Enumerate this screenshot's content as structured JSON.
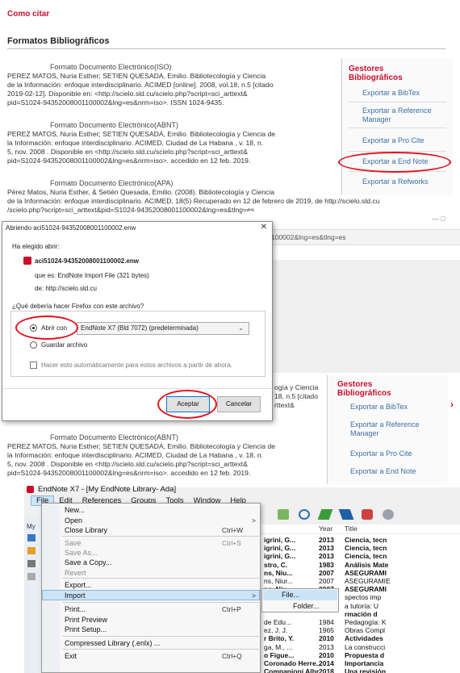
{
  "cite_page": {
    "heading": "Como citar",
    "section_title": "Formatos Bibliográficos",
    "formats": [
      {
        "title": "Formato Documento Electrónico(ISO)",
        "lines": [
          "PEREZ MATOS, Nuria Esther; SETIEN QUESADA, Emilio. Bibliotecología y Ciencia",
          "de la Información: enfoque interdisciplinario. ACIMED [online]. 2008, vol.18, n.5 [citado",
          "2019-02-12]. Disponible en: <http://scielo.sld.cu/scielo.php?script=sci_arttext&",
          "pid=S1024-94352008001100002&lng=es&nrm=iso>. ISSN 1024-9435."
        ]
      },
      {
        "title": "Formato Documento Electrónico(ABNT)",
        "lines": [
          "PEREZ MATOS, Nuria Esther; SETIEN QUESADA, Emilio. Bibliotecología y Ciencia de",
          "la Información: enfoque interdisciplinario. ACIMED, Ciudad de La Habana , v. 18, n.",
          "5, nov. 2008 . Disponible en <http://scielo.sld.cu/scielo.php?script=sci_arttext&",
          "pid=S1024-94352008001100002&lng=es&nrm=iso>. accedido en 12 feb. 2019."
        ]
      },
      {
        "title": "Formato Documento Electrónico(APA)",
        "lines": [
          "Pérez Matos, Nuria Esther, & Setién Quesada, Emilio. (2008). Bibliotecología y Ciencia",
          "de la Información: enfoque interdisciplinario. ACIMED, 18(5) Recuperado en 12 de febrero de 2019, de http://scielo.sld.cu",
          "/scielo.php?script=sci_arttext&pid=S1024-94352008001100002&lng=es&tlng=es."
        ]
      }
    ],
    "gestores": {
      "title_line1": "Gestores",
      "title_line2": "Bibliográficos",
      "links": [
        "Exportar a BibTex",
        "Exportar a Reference",
        "Manager",
        "Exportar a Pro Cite",
        "Exportar a End Note",
        "Exportar a Refworks"
      ]
    },
    "url_fragment": "100002&lng=es&tlng=es",
    "window_controls": "—   □"
  },
  "dialog": {
    "title": "Abriendo aci51024-94352008001100002.enw",
    "close_glyph": "✕",
    "chosen_label": "Ha elegido abrir:",
    "filename": "aci51024-94352008001100002.enw",
    "type_label": "que es: EndNote Import File (321 bytes)",
    "from_label": "de: http://scielo.sld.cu",
    "question": "¿Qué debería hacer Firefox con este archivo?",
    "open_with_label": "Abrir con",
    "open_with_app": "EndNote X7 (Bld 7072) (predeterminada)",
    "save_label": "Guardar archivo",
    "auto_label": "Hacer esto automáticamente para estos archivos a partir de ahora.",
    "accept": "Aceptar",
    "cancel": "Cancelar"
  },
  "second_page": {
    "snippet_lines": [
      "ogía y Ciencia",
      "18, n.5 [citado",
      "rttext&"
    ],
    "abnt_title": "Formato Documento Electrónico(ABNT)",
    "abnt_lines": [
      "PEREZ MATOS, Nuria Esther; SETIEN QUESADA, Emilio. Bibliotecología y Ciencia de",
      "la Información: enfoque interdisciplinario. ACIMED, Ciudad de La Habana , v. 18, n.",
      "5, nov. 2008 . Disponible en <http://scielo.sld.cu/scielo.php?script=sci_arttext&",
      "pid=S1024-94352008001100002&lng=es&nrm=iso>. accedido en 12 feb. 2019."
    ],
    "gestores": {
      "title_line1": "Gestores",
      "title_line2": "Bibliográficos",
      "links": [
        "Exportar a BibTex",
        "Exportar a Reference",
        "Manager",
        "Exportar a Pro Cite",
        "Exportar a End Note"
      ]
    }
  },
  "endnote": {
    "title": "EndNote X7 - [My EndNote Library- Ada]",
    "menubar": [
      "File",
      "Edit",
      "References",
      "Groups",
      "Tools",
      "Window",
      "Help"
    ],
    "file_menu": [
      {
        "label": "New...",
        "shortcut": "",
        "disabled": false
      },
      {
        "label": "Open",
        "shortcut": ">",
        "disabled": false
      },
      {
        "label": "Close Library",
        "shortcut": "Ctrl+W",
        "disabled": false
      },
      {
        "label": "Save",
        "shortcut": "Ctrl+S",
        "disabled": true
      },
      {
        "label": "Save As...",
        "shortcut": "",
        "disabled": true
      },
      {
        "label": "Save a Copy...",
        "shortcut": "",
        "disabled": false
      },
      {
        "label": "Revert",
        "shortcut": "",
        "disabled": true
      },
      {
        "label": "Export...",
        "shortcut": "",
        "disabled": false
      },
      {
        "label": "Import",
        "shortcut": ">",
        "disabled": false
      },
      {
        "label": "Print...",
        "shortcut": "Ctrl+P",
        "disabled": false
      },
      {
        "label": "Print Preview",
        "shortcut": "",
        "disabled": false
      },
      {
        "label": "Print Setup...",
        "shortcut": "",
        "disabled": false
      },
      {
        "label": "Compressed Library (.enlx) ...",
        "shortcut": "",
        "disabled": false
      },
      {
        "label": "Exit",
        "shortcut": "Ctrl+Q",
        "disabled": false
      }
    ],
    "import_submenu": [
      "File...",
      "Folder..."
    ],
    "table": {
      "headers": [
        "Year",
        "Title"
      ],
      "rows": [
        [
          "igrini, G...",
          "2013",
          "Ciencia, tecn"
        ],
        [
          "igrini, G...",
          "2013",
          "Ciencia, tecn"
        ],
        [
          "igrini, G...",
          "2013",
          "Ciencia, tecn"
        ],
        [
          "stro, C.",
          "1983",
          "Análisis Mate"
        ],
        [
          "ns, Niu...",
          "2007",
          "ASEGURAMI"
        ],
        [
          "ns, Niur...",
          "2007",
          "ASEGURAMIE"
        ],
        [
          "ns, Niu...",
          "2007",
          "ASEGURAMI"
        ],
        [
          "",
          "",
          "spectos imp"
        ],
        [
          "",
          "",
          "a tutoría: U"
        ],
        [
          "",
          "",
          "rmación d"
        ],
        [
          "de Edu...",
          "1984",
          "Pedagogía: K"
        ],
        [
          "ez, J. J.",
          "1965",
          "Obras Compl"
        ],
        [
          "r Brito, Y.",
          "2010",
          "Actividades"
        ],
        [
          "ga, M., ...",
          "2013",
          "La construcci"
        ],
        [
          "o Figue...",
          "2010",
          "Propuesta d"
        ],
        [
          "Coronado Herre...",
          "2014",
          "Importancia"
        ],
        [
          "Companioni Albr...",
          "2018",
          "Una revisión"
        ]
      ]
    },
    "sidebar_labels": [
      "My"
    ]
  },
  "colors": {
    "brand_red": "#c8102e",
    "highlight_red": "#e0141e",
    "menu_highlight": "#cce4f7"
  }
}
